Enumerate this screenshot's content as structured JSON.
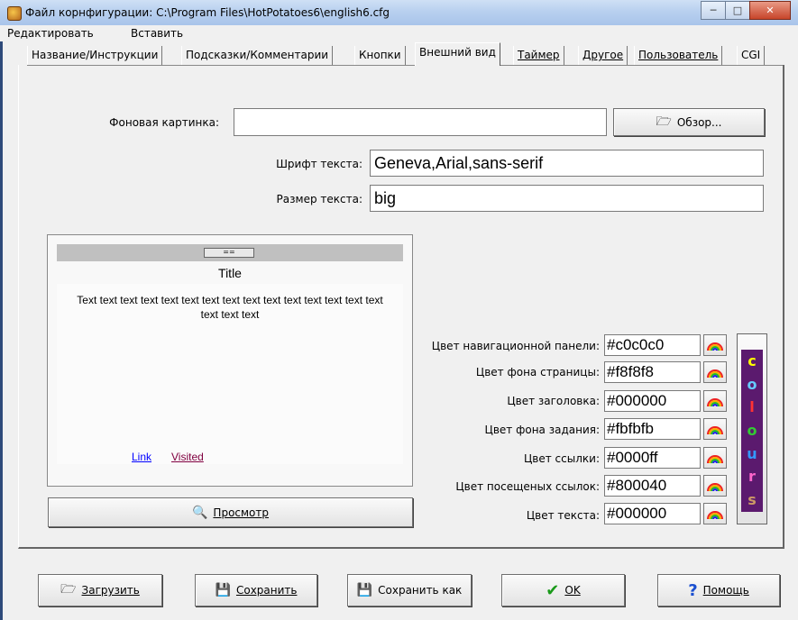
{
  "window": {
    "title": "Файл корнфигурации: C:\\Program Files\\HotPotatoes6\\english6.cfg",
    "minimize_icon": "minimize-icon",
    "maximize_icon": "maximize-icon",
    "close_icon": "close-icon"
  },
  "menubar": {
    "edit": "Редактировать",
    "insert": "Вставить"
  },
  "tabs": [
    {
      "label": "Название/Инструкции"
    },
    {
      "label": "Подсказки/Комментарии"
    },
    {
      "label": "Кнопки"
    },
    {
      "label": "Внешний вид"
    },
    {
      "label": "Таймер"
    },
    {
      "label": "Другое"
    },
    {
      "label": "Пользователь"
    },
    {
      "label": "CGI"
    }
  ],
  "appearance": {
    "bg_image_label": "Фоновая картинка:",
    "bg_image_value": "",
    "browse_label": "Обзор...",
    "font_label": "Шрифт текста:",
    "font_value": "Geneva,Arial,sans-serif",
    "size_label": "Размер текста:",
    "size_value": "big"
  },
  "preview": {
    "nav_button": "==",
    "title": "Title",
    "body_text": "Text text text text text text text text text text text text text text text text text text",
    "link": "Link",
    "visited": "Visited",
    "preview_button": "Просмотр"
  },
  "colors": [
    {
      "label": "Цвет навигационной панели:",
      "value": "#c0c0c0"
    },
    {
      "label": "Цвет фона страницы:",
      "value": "#f8f8f8"
    },
    {
      "label": "Цвет заголовка:",
      "value": "#000000"
    },
    {
      "label": "Цвет фона задания:",
      "value": "#fbfbfb"
    },
    {
      "label": "Цвет ссылки:",
      "value": "#0000ff"
    },
    {
      "label": "Цвет посещеных ссылок:",
      "value": "#800040"
    },
    {
      "label": "Цвет текста:",
      "value": "#000000"
    }
  ],
  "colours_letters": [
    {
      "ch": "c",
      "color": "#ffff00"
    },
    {
      "ch": "o",
      "color": "#66ccff"
    },
    {
      "ch": "l",
      "color": "#ff3333"
    },
    {
      "ch": "o",
      "color": "#33cc33"
    },
    {
      "ch": "u",
      "color": "#3399ff"
    },
    {
      "ch": "r",
      "color": "#ff66cc"
    },
    {
      "ch": "s",
      "color": "#cc9966"
    }
  ],
  "bottom_buttons": {
    "load": "Загрузить",
    "save": "Сохранить",
    "save_as": "Сохранить как",
    "ok": "OK",
    "help": "Помощь"
  }
}
